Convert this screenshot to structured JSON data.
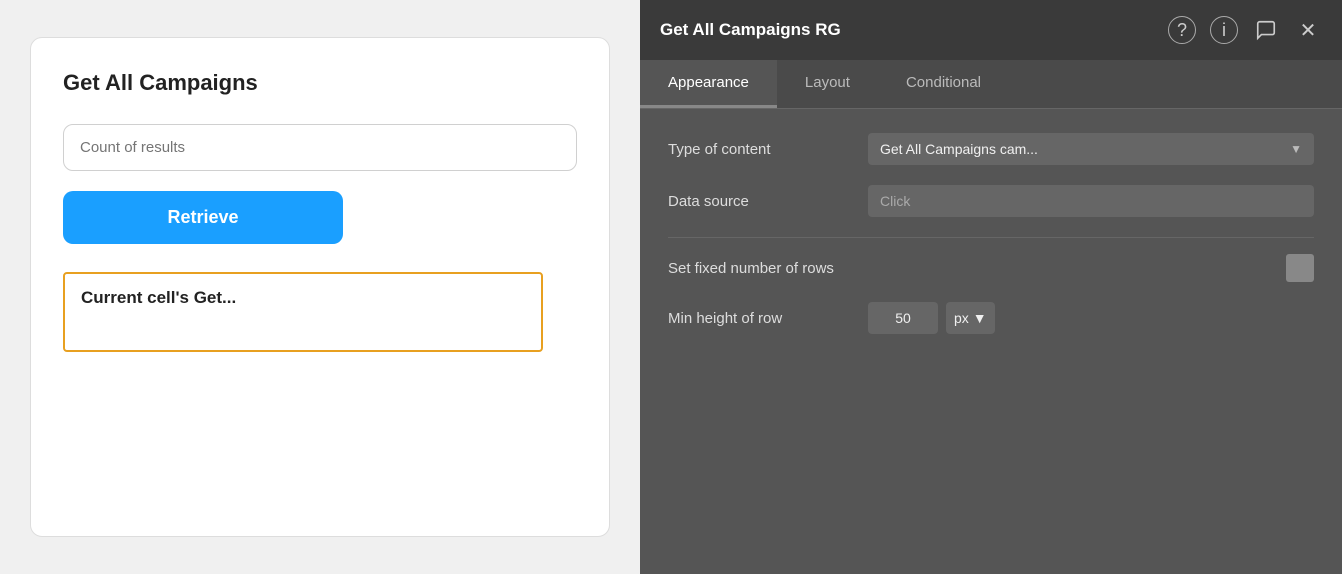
{
  "left": {
    "card_title": "Get All Campaigns",
    "count_input_placeholder": "Count of results",
    "retrieve_button_label": "Retrieve",
    "cell_text": "Current cell's Get..."
  },
  "right": {
    "panel_title": "Get All Campaigns RG",
    "icons": {
      "help": "?",
      "info": "i",
      "chat": "💬",
      "close": "✕"
    },
    "tabs": [
      {
        "id": "appearance",
        "label": "Appearance",
        "active": true
      },
      {
        "id": "layout",
        "label": "Layout",
        "active": false
      },
      {
        "id": "conditional",
        "label": "Conditional",
        "active": false
      }
    ],
    "fields": {
      "type_of_content_label": "Type of content",
      "type_of_content_value": "Get All Campaigns cam...",
      "data_source_label": "Data source",
      "data_source_placeholder": "Click",
      "set_fixed_rows_label": "Set fixed number of rows",
      "min_height_label": "Min height of row",
      "min_height_value": "50",
      "min_height_unit": "px"
    }
  }
}
